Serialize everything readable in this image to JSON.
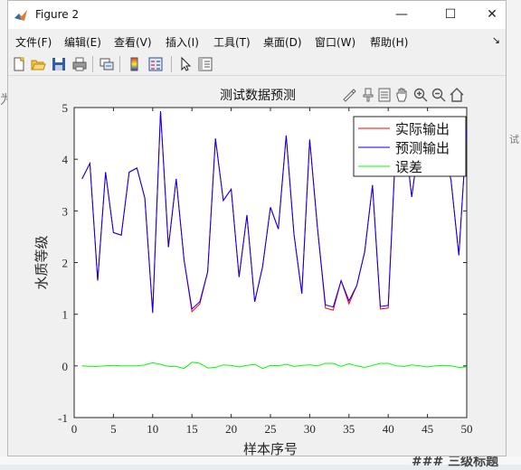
{
  "window": {
    "title": "Figure 2"
  },
  "window_controls": {
    "minimize": "—",
    "maximize": "☐",
    "close": "✕"
  },
  "menu": {
    "items": [
      {
        "label": "文件(F)",
        "key": "file"
      },
      {
        "label": "编辑(E)",
        "key": "edit"
      },
      {
        "label": "查看(V)",
        "key": "view"
      },
      {
        "label": "插入(I)",
        "key": "insert"
      },
      {
        "label": "工具(T)",
        "key": "tools"
      },
      {
        "label": "桌面(D)",
        "key": "desktop"
      },
      {
        "label": "窗口(W)",
        "key": "window"
      },
      {
        "label": "帮助(H)",
        "key": "help"
      }
    ],
    "overflow": "↘"
  },
  "toolbar": {
    "icons": [
      "new-figure-icon",
      "open-file-icon",
      "save-icon",
      "print-icon",
      "link-plot-icon",
      "insert-colorbar-icon",
      "insert-legend-icon",
      "edit-plot-icon",
      "property-inspector-icon"
    ]
  },
  "plot_tools": [
    "brush-icon",
    "data-tips-icon",
    "restore-view-icon",
    "pan-icon",
    "zoom-in-icon",
    "zoom-out-icon",
    "home-icon"
  ],
  "background_text": {
    "a": "为",
    "b": "试",
    "c": "### 三级标题"
  },
  "colors": {
    "actual": "#ff0000",
    "predicted": "#0000ff",
    "error": "#00ff00"
  },
  "chart_data": {
    "type": "line",
    "title": "测试数据预测",
    "xlabel": "样本序号",
    "ylabel": "水质等级",
    "xlim": [
      0,
      50
    ],
    "ylim": [
      -1,
      5
    ],
    "xticks": [
      0,
      5,
      10,
      15,
      20,
      25,
      30,
      35,
      40,
      45,
      50
    ],
    "yticks": [
      -1,
      0,
      1,
      2,
      3,
      4,
      5
    ],
    "legend_position": "top-right",
    "x": [
      1,
      2,
      3,
      4,
      5,
      6,
      7,
      8,
      9,
      10,
      11,
      12,
      13,
      14,
      15,
      16,
      17,
      18,
      19,
      20,
      21,
      22,
      23,
      24,
      25,
      26,
      27,
      28,
      29,
      30,
      31,
      32,
      33,
      34,
      35,
      36,
      37,
      38,
      39,
      40,
      41,
      42,
      43,
      44,
      45,
      46,
      47,
      48,
      49,
      50
    ],
    "series": [
      {
        "name": "实际输出",
        "color": "#ff0000",
        "values": [
          3.62,
          3.92,
          1.65,
          3.75,
          2.58,
          2.53,
          3.75,
          3.83,
          3.25,
          1.02,
          4.93,
          2.3,
          3.62,
          2.05,
          1.05,
          1.2,
          1.82,
          4.4,
          3.2,
          3.42,
          1.72,
          2.92,
          1.24,
          1.92,
          3.07,
          2.65,
          4.46,
          2.55,
          1.4,
          4.38,
          2.65,
          1.12,
          1.08,
          1.65,
          1.2,
          1.56,
          2.21,
          3.5,
          1.1,
          1.12,
          4.41,
          4.6,
          3.27,
          4.42,
          4.81,
          4.4,
          4.2,
          3.6,
          2.14,
          4.58
        ]
      },
      {
        "name": "预测输出",
        "color": "#0000ff",
        "values": [
          3.62,
          3.92,
          1.65,
          3.75,
          2.58,
          2.53,
          3.75,
          3.83,
          3.25,
          1.04,
          4.93,
          2.3,
          3.62,
          2.05,
          1.1,
          1.24,
          1.82,
          4.4,
          3.2,
          3.42,
          1.72,
          2.92,
          1.24,
          1.92,
          3.07,
          2.65,
          4.46,
          2.55,
          1.4,
          4.38,
          2.65,
          1.18,
          1.14,
          1.65,
          1.26,
          1.56,
          2.21,
          3.5,
          1.15,
          1.17,
          4.41,
          4.6,
          3.27,
          4.42,
          4.81,
          4.4,
          4.2,
          3.6,
          2.14,
          4.58
        ]
      },
      {
        "name": "误差",
        "color": "#00ff00",
        "values": [
          0.0,
          -0.01,
          -0.01,
          0.0,
          0.01,
          0.0,
          0.0,
          0.0,
          0.02,
          0.06,
          0.03,
          -0.01,
          -0.01,
          -0.05,
          0.07,
          0.05,
          -0.04,
          -0.03,
          0.02,
          0.01,
          -0.02,
          0.01,
          0.03,
          -0.05,
          0.01,
          0.0,
          0.03,
          -0.01,
          0.01,
          0.02,
          0.0,
          0.05,
          0.05,
          -0.01,
          0.04,
          0.0,
          -0.03,
          0.01,
          0.05,
          0.05,
          0.0,
          -0.01,
          0.02,
          0.0,
          -0.02,
          0.0,
          0.01,
          0.0,
          -0.03,
          -0.02
        ]
      }
    ]
  }
}
